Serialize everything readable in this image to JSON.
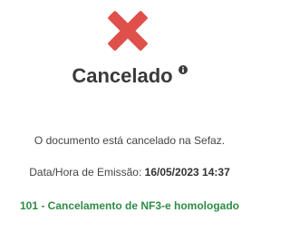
{
  "status": {
    "icon": "close-icon",
    "icon_color": "#e0504a",
    "title": "Cancelado",
    "info_icon": "info-icon",
    "message": "O documento está cancelado na Sefaz.",
    "datetime_label": "Data/Hora de Emissão:",
    "datetime_value": "16/05/2023 14:37",
    "status_code_text": "101 - Cancelamento de NF3-e homologado",
    "status_code_color": "#2e8b45"
  }
}
